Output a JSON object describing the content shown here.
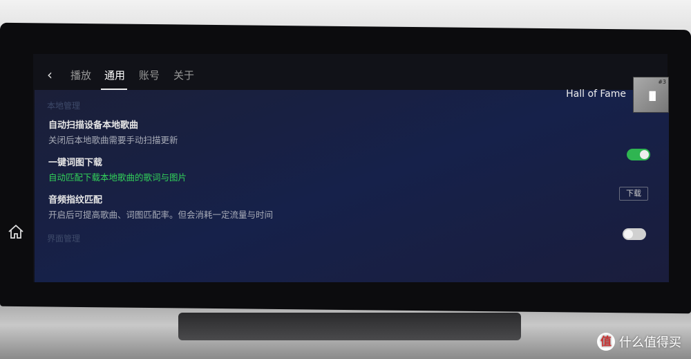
{
  "topbar": {
    "back_icon": "chevron-left-icon",
    "tabs": [
      {
        "label": "播放"
      },
      {
        "label": "通用",
        "active": true
      },
      {
        "label": "账号"
      },
      {
        "label": "关于"
      }
    ]
  },
  "now_playing": {
    "title": "Hall of Fame",
    "cover_number": "#3"
  },
  "settings": {
    "sections": [
      {
        "label": "本地管理"
      },
      {
        "label": "界面管理"
      }
    ],
    "items": [
      {
        "title": "自动扫描设备本地歌曲",
        "subtitle": "关闭后本地歌曲需要手动扫描更新",
        "toggle_on": true
      },
      {
        "title": "一键词图下载",
        "subtitle": "自动匹配下载本地歌曲的歌词与图片",
        "button": "下载"
      },
      {
        "title": "音频指纹匹配",
        "subtitle": "开启后可提高歌曲、词图匹配率。但会消耗一定流量与时间",
        "toggle_on": false
      }
    ]
  },
  "colors": {
    "accent": "#32d25a",
    "toggle_on": "#2fb551",
    "toggle_off": "#d0d0d0"
  },
  "watermark": {
    "text": "什么值得买",
    "logo": "值"
  }
}
